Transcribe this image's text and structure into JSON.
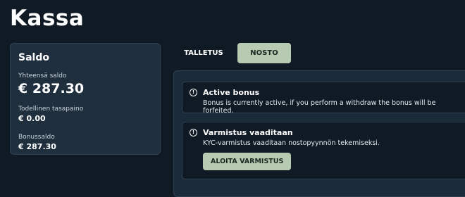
{
  "page": {
    "title": "Kassa"
  },
  "balance": {
    "title": "Saldo",
    "total_label": "Yhteensä saldo",
    "total_value": "€ 287.30",
    "real_label": "Todellinen tasapaino",
    "real_value": "€ 0.00",
    "bonus_label": "Bonussaldo",
    "bonus_value": "€ 287.30"
  },
  "tabs": [
    {
      "label": "TALLETUS",
      "active": false
    },
    {
      "label": "NOSTO",
      "active": true
    }
  ],
  "alerts": {
    "bonus": {
      "icon": "info-icon",
      "title": "Active bonus",
      "text": "Bonus is currently active, if you perform a withdraw the bonus will be forfeited."
    },
    "kyc": {
      "icon": "info-icon",
      "title": "Varmistus vaaditaan",
      "text": "KYC-varmistus vaaditaan nostopyynnön tekemiseksi.",
      "button_label": "ALOITA VARMISTUS"
    }
  },
  "colors": {
    "background": "#0f1a25",
    "card": "#1f2f3e",
    "accent": "#b7cbb3"
  }
}
